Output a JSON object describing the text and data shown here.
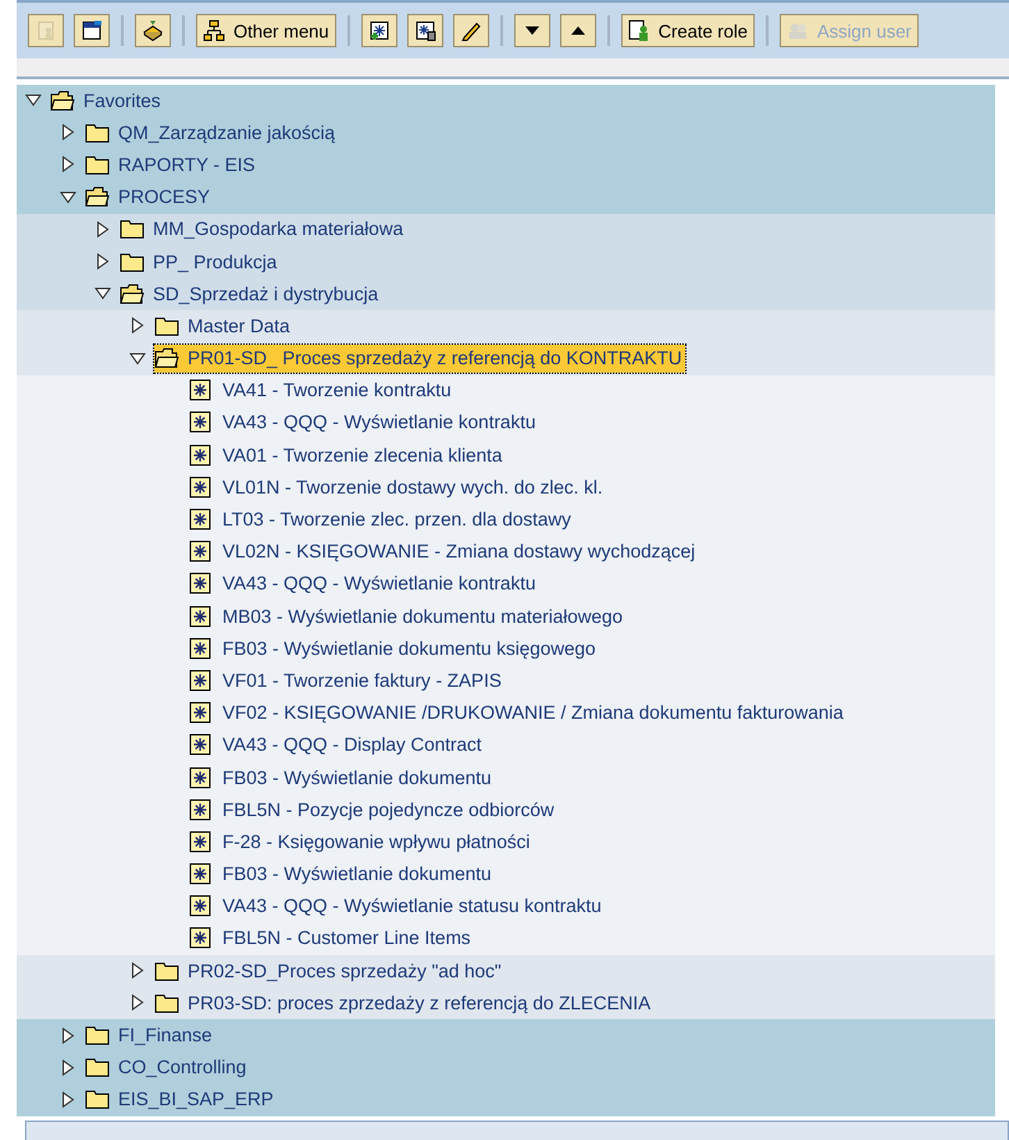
{
  "toolbar": {
    "groups": [
      [
        {
          "disabled": true
        },
        {
          "disabled": false
        }
      ],
      [
        {
          "disabled": false
        }
      ],
      [
        {
          "label": "Other menu",
          "disabled": false
        }
      ],
      [
        {
          "disabled": false
        },
        {
          "disabled": false
        },
        {
          "disabled": false
        }
      ],
      [
        {
          "disabled": false
        },
        {
          "disabled": false
        }
      ],
      [
        {
          "label": "Create role",
          "disabled": false
        }
      ],
      [
        {
          "label": "Assign user",
          "disabled": true
        }
      ]
    ]
  },
  "tree": [
    {
      "label": "Favorites",
      "kind": "folder",
      "expanded": true,
      "selected": false,
      "children": [
        {
          "label": "QM_Zarządzanie jakością",
          "kind": "folder",
          "expanded": false,
          "selected": false
        },
        {
          "label": "RAPORTY - EIS",
          "kind": "folder",
          "expanded": false,
          "selected": false
        },
        {
          "label": "PROCESY",
          "kind": "folder",
          "expanded": true,
          "selected": false,
          "children": [
            {
              "label": "MM_Gospodarka materiałowa",
              "kind": "folder",
              "expanded": false,
              "selected": false
            },
            {
              "label": "PP_ Produkcja",
              "kind": "folder",
              "expanded": false,
              "selected": false
            },
            {
              "label": "SD_Sprzedaż i dystrybucja",
              "kind": "folder",
              "expanded": true,
              "selected": false,
              "children": [
                {
                  "label": "Master Data",
                  "kind": "folder",
                  "expanded": false,
                  "selected": false
                },
                {
                  "label": "PR01-SD_ Proces sprzedaży z referencją do KONTRAKTU",
                  "kind": "folder",
                  "expanded": true,
                  "selected": true,
                  "children": [
                    {
                      "label": "VA41 - Tworzenie kontraktu",
                      "kind": "transaction",
                      "selected": false
                    },
                    {
                      "label": "VA43 - QQQ - Wyświetlanie kontraktu",
                      "kind": "transaction",
                      "selected": false
                    },
                    {
                      "label": "VA01 - Tworzenie zlecenia klienta",
                      "kind": "transaction",
                      "selected": false
                    },
                    {
                      "label": "VL01N - Tworzenie dostawy wych. do zlec. kl.",
                      "kind": "transaction",
                      "selected": false
                    },
                    {
                      "label": "LT03 - Tworzenie zlec. przen. dla dostawy",
                      "kind": "transaction",
                      "selected": false
                    },
                    {
                      "label": "VL02N - KSIĘGOWANIE - Zmiana dostawy wychodzącej",
                      "kind": "transaction",
                      "selected": false
                    },
                    {
                      "label": "VA43 - QQQ - Wyświetlanie kontraktu",
                      "kind": "transaction",
                      "selected": false
                    },
                    {
                      "label": "MB03 - Wyświetlanie dokumentu materiałowego",
                      "kind": "transaction",
                      "selected": false
                    },
                    {
                      "label": "FB03 - Wyświetlanie dokumentu księgowego",
                      "kind": "transaction",
                      "selected": false
                    },
                    {
                      "label": "VF01 - Tworzenie faktury - ZAPIS",
                      "kind": "transaction",
                      "selected": false
                    },
                    {
                      "label": "VF02 - KSIĘGOWANIE /DRUKOWANIE / Zmiana dokumentu fakturowania",
                      "kind": "transaction",
                      "selected": false
                    },
                    {
                      "label": "VA43 - QQQ - Display Contract",
                      "kind": "transaction",
                      "selected": false
                    },
                    {
                      "label": "FB03 - Wyświetlanie dokumentu",
                      "kind": "transaction",
                      "selected": false
                    },
                    {
                      "label": "FBL5N - Pozycje pojedyncze odbiorców",
                      "kind": "transaction",
                      "selected": false
                    },
                    {
                      "label": "F-28 - Księgowanie wpływu płatności",
                      "kind": "transaction",
                      "selected": false
                    },
                    {
                      "label": "FB03 - Wyświetlanie dokumentu",
                      "kind": "transaction",
                      "selected": false
                    },
                    {
                      "label": "VA43 - QQQ - Wyświetlanie statusu kontraktu",
                      "kind": "transaction",
                      "selected": false
                    },
                    {
                      "label": "FBL5N - Customer Line Items",
                      "kind": "transaction",
                      "selected": false
                    }
                  ]
                },
                {
                  "label": "PR02-SD_Proces sprzedaży \"ad hoc\"",
                  "kind": "folder",
                  "expanded": false,
                  "selected": false
                },
                {
                  "label": "PR03-SD: proces zprzedaży z referencją do ZLECENIA",
                  "kind": "folder",
                  "expanded": false,
                  "selected": false
                }
              ]
            }
          ]
        },
        {
          "label": "FI_Finanse",
          "kind": "folder",
          "expanded": false,
          "selected": false
        },
        {
          "label": "CO_Controlling",
          "kind": "folder",
          "expanded": false,
          "selected": false
        },
        {
          "label": "EIS_BI_SAP_ERP",
          "kind": "folder",
          "expanded": false,
          "selected": false
        }
      ]
    }
  ]
}
